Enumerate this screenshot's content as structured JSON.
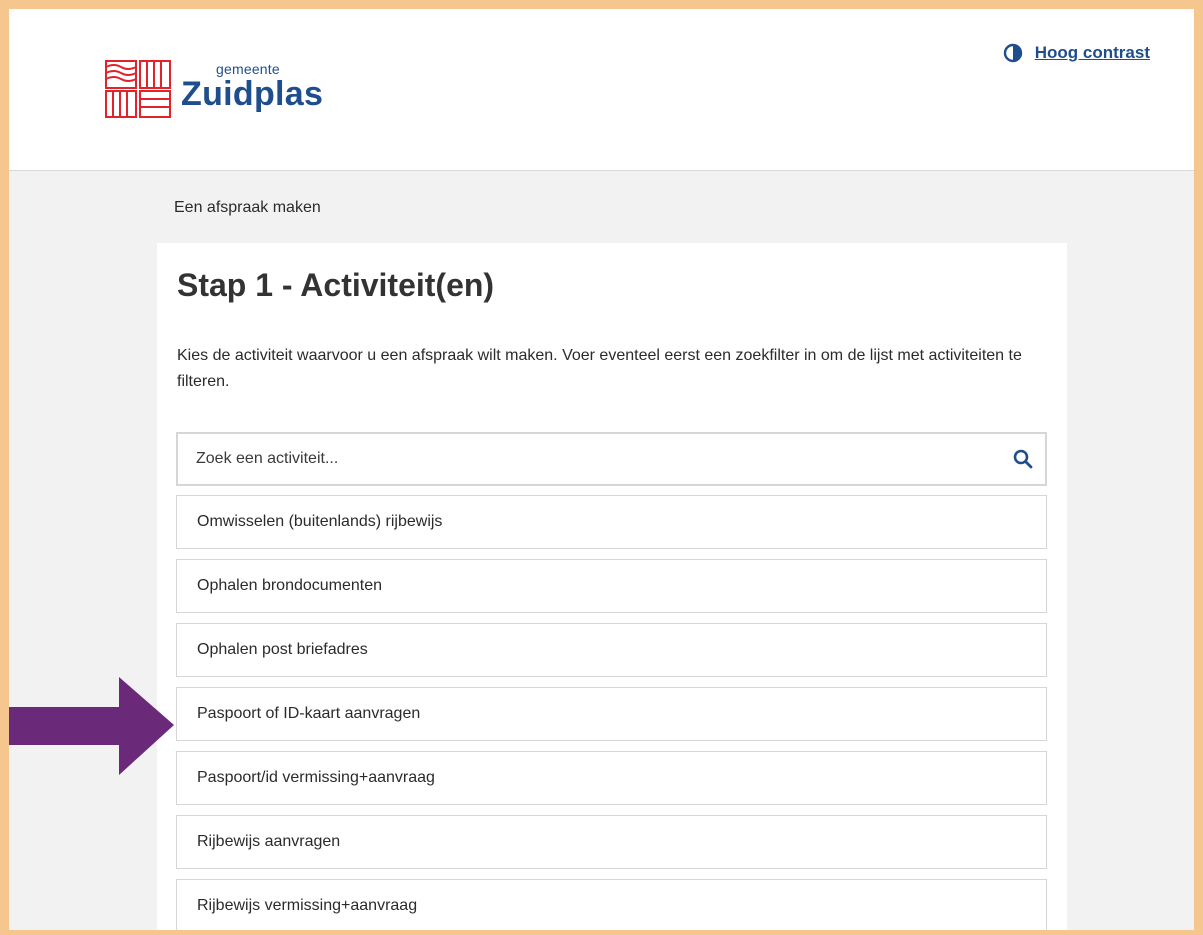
{
  "header": {
    "logo_small": "gemeente",
    "logo_big": "Zuidplas",
    "contrast_label": "Hoog contrast"
  },
  "breadcrumb": "Een afspraak maken",
  "main": {
    "title": "Stap 1 - Activiteit(en)",
    "intro": "Kies de activiteit waarvoor u een afspraak wilt maken. Voer eventeel eerst een zoekfilter in om de lijst met activiteiten te filteren.",
    "search_placeholder": "Zoek een activiteit...",
    "activities": [
      "Omwisselen (buitenlands) rijbewijs",
      "Ophalen brondocumenten",
      "Ophalen post briefadres",
      "Paspoort of ID-kaart aanvragen",
      "Paspoort/id vermissing+aanvraag",
      "Rijbewijs aanvragen",
      "Rijbewijs vermissing+aanvraag"
    ]
  },
  "colors": {
    "frame": "#f5c78e",
    "brand_blue": "#1f4e8c",
    "logo_red": "#e0242b",
    "arrow": "#6b2a79"
  },
  "icons": {
    "logo": "zuidplas-logo-icon",
    "contrast": "contrast-icon",
    "search": "search-icon",
    "annotation": "arrow-right-icon"
  }
}
